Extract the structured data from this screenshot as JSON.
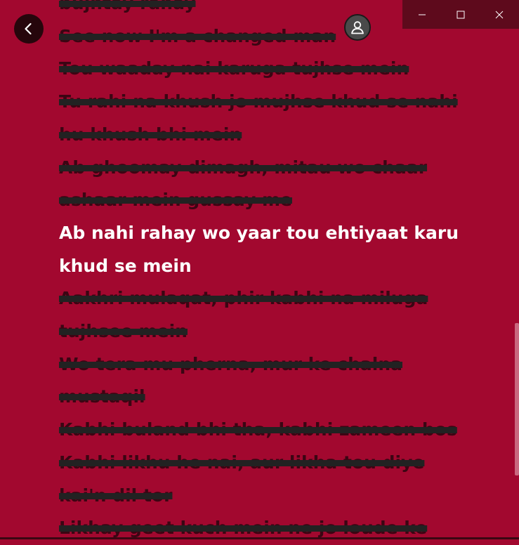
{
  "window": {
    "controls": [
      "minimize",
      "maximize",
      "close"
    ],
    "icons": {
      "back": "back-arrow-icon",
      "profile": "user-icon"
    }
  },
  "colors": {
    "background": "#a2082f",
    "active_text": "#ffffff",
    "inactive_text": "#2a0710"
  },
  "lyrics": {
    "lines": [
      {
        "text": "bujhtay rahay",
        "active": false
      },
      {
        "text": "See now I'm a changed man",
        "active": false
      },
      {
        "text": "Tou waaday nai karuga tujhse mein",
        "active": false
      },
      {
        "text": "Tu rahi na khush jo mujhse khud se nahi",
        "active": false
      },
      {
        "text": "hu khush bhi mein",
        "active": false
      },
      {
        "text": "Ab ghoomay dimagh, mitau wo chaar",
        "active": false
      },
      {
        "text": "ashaar mein gussay me",
        "active": false
      },
      {
        "text": "Ab nahi rahay wo yaar tou ehtiyaat karu",
        "active": true
      },
      {
        "text": "khud se mein",
        "active": true
      },
      {
        "text": "Aakhri mulaqat, phir kabhi na miluga",
        "active": false
      },
      {
        "text": "tujhsee mein",
        "active": false
      },
      {
        "text": "Wo tera mu pherna, mur ke chalna",
        "active": false
      },
      {
        "text": "mustaqil",
        "active": false
      },
      {
        "text": "Kabhi buland bhi tha, kabhi zameen bos",
        "active": false
      },
      {
        "text": "Kabhi likhu he nai, aur likha tou diye",
        "active": false
      },
      {
        "text": "kai'n dil tor",
        "active": false
      },
      {
        "text": "Likhay geet kuch mein ne jo loude ke",
        "active": false
      }
    ]
  }
}
